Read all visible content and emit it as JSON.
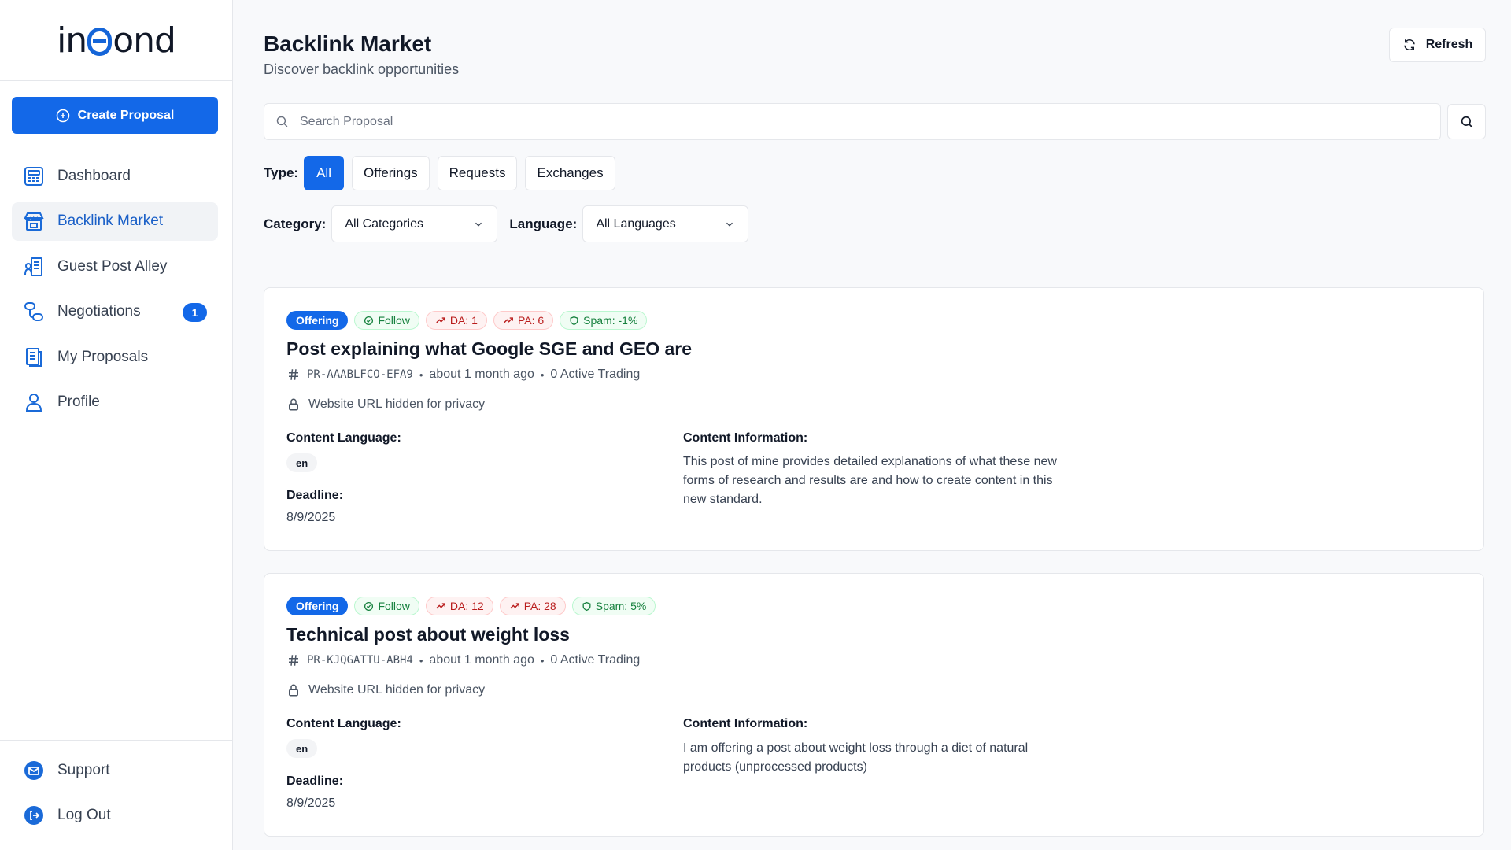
{
  "app": {
    "logo_left": "in",
    "logo_right": "ond"
  },
  "sidebar": {
    "create_label": "Create Proposal",
    "items": [
      {
        "label": "Dashboard",
        "icon": "dashboard-icon"
      },
      {
        "label": "Backlink Market",
        "icon": "store-icon"
      },
      {
        "label": "Guest Post Alley",
        "icon": "guest-post-icon"
      },
      {
        "label": "Negotiations",
        "icon": "negotiations-icon",
        "badge": "1"
      },
      {
        "label": "My Proposals",
        "icon": "document-icon"
      },
      {
        "label": "Profile",
        "icon": "user-icon"
      }
    ],
    "bottom": [
      {
        "label": "Support",
        "icon": "support-icon"
      },
      {
        "label": "Log Out",
        "icon": "logout-icon"
      }
    ]
  },
  "header": {
    "title": "Backlink Market",
    "subtitle": "Discover backlink opportunities",
    "refresh_label": "Refresh"
  },
  "search": {
    "placeholder": "Search Proposal",
    "value": ""
  },
  "filters": {
    "type_label": "Type:",
    "types": [
      "All",
      "Offerings",
      "Requests",
      "Exchanges"
    ],
    "active_type": "All",
    "category_label": "Category:",
    "category_value": "All Categories",
    "language_label": "Language:",
    "language_value": "All Languages"
  },
  "proposals": [
    {
      "type": "Offering",
      "follow": "Follow",
      "da": "DA: 1",
      "pa": "PA: 6",
      "spam": "Spam: -1%",
      "title": "Post explaining what Google SGE and GEO are",
      "id": "PR-AAABLFCO-EFA9",
      "time": "about 1 month ago",
      "trading": "0 Active Trading",
      "privacy": "Website URL hidden for privacy",
      "content_language_label": "Content Language:",
      "language": "en",
      "deadline_label": "Deadline:",
      "deadline": "8/9/2025",
      "info_label": "Content Information:",
      "info": "This post of mine provides detailed explanations of what these new forms of research and results are and how to create content in this new standard."
    },
    {
      "type": "Offering",
      "follow": "Follow",
      "da": "DA: 12",
      "pa": "PA: 28",
      "spam": "Spam: 5%",
      "title": "Technical post about weight loss",
      "id": "PR-KJQGATTU-ABH4",
      "time": "about 1 month ago",
      "trading": "0 Active Trading",
      "privacy": "Website URL hidden for privacy",
      "content_language_label": "Content Language:",
      "language": "en",
      "deadline_label": "Deadline:",
      "deadline": "8/9/2025",
      "info_label": "Content Information:",
      "info": "I am offering a post about weight loss through a diet of natural products (unprocessed products)"
    }
  ],
  "colors": {
    "accent": "#1368e8",
    "follow_green": "#15803d",
    "metric_red": "#b91c1c"
  }
}
